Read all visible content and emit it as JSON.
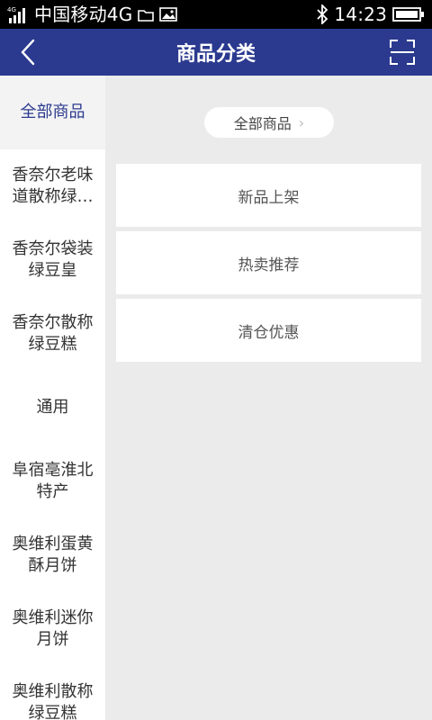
{
  "status_bar": {
    "carrier": "中国移动4G",
    "network_tag": "4G",
    "time": "14:23"
  },
  "header": {
    "title": "商品分类"
  },
  "sidebar": {
    "items": [
      {
        "label": "全部商品",
        "active": true
      },
      {
        "label": "香奈尔老味道散称绿…"
      },
      {
        "label": "香奈尔袋装绿豆皇"
      },
      {
        "label": "香奈尔散称绿豆糕"
      },
      {
        "label": "通用"
      },
      {
        "label": "阜宿亳淮北特产"
      },
      {
        "label": "奥维利蛋黄酥月饼"
      },
      {
        "label": "奥维利迷你月饼"
      },
      {
        "label": "奥维利散称绿豆糕"
      }
    ]
  },
  "main": {
    "breadcrumb": {
      "label": "全部商品"
    },
    "cards": [
      {
        "label": "新品上架"
      },
      {
        "label": "热卖推荐"
      },
      {
        "label": "清仓优惠"
      }
    ]
  },
  "colors": {
    "header_bg": "#2b3a8f",
    "active_text": "#2b3a8f",
    "page_bg": "#ebebeb"
  }
}
